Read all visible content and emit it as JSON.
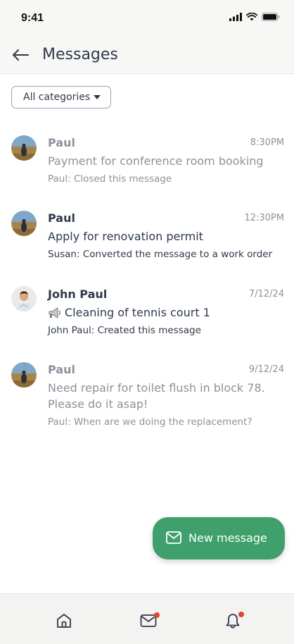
{
  "status_bar": {
    "time": "9:41",
    "icons": [
      "signal-icon",
      "wifi-icon",
      "battery-icon"
    ]
  },
  "header": {
    "back_icon": "arrow-left-icon",
    "title": "Messages"
  },
  "filter": {
    "selected": "All categories",
    "icon": "caret-down-icon"
  },
  "messages": [
    {
      "sender": "Paul",
      "time": "8:30PM",
      "subject": "Payment for conference room booking",
      "preview": "Paul: Closed this message",
      "state": "read",
      "avatar": "landscape-photo"
    },
    {
      "sender": "Paul",
      "time": "12:30PM",
      "subject": "Apply for renovation permit",
      "preview": "Susan: Converted the message to a work order",
      "state": "unread",
      "avatar": "landscape-photo"
    },
    {
      "sender": "John Paul",
      "time": "7/12/24",
      "subject_icon": "megaphone-icon",
      "subject": "Cleaning of tennis court 1",
      "preview": "John Paul: Created this message",
      "state": "unread",
      "avatar": "portrait-photo"
    },
    {
      "sender": "Paul",
      "time": "9/12/24",
      "subject": "Need repair for toilet flush in block 78. Please do it asap!",
      "preview": "Paul: When are we doing the replacement?",
      "state": "read",
      "avatar": "landscape-photo"
    }
  ],
  "fab": {
    "label": "New message",
    "icon": "envelope-icon",
    "color": "#3fa06b"
  },
  "bottom_nav": {
    "items": [
      {
        "icon": "home-icon",
        "badge": false
      },
      {
        "icon": "envelope-icon",
        "badge": true
      },
      {
        "icon": "bell-icon",
        "badge": true
      }
    ],
    "badge_color": "#e0452f"
  }
}
